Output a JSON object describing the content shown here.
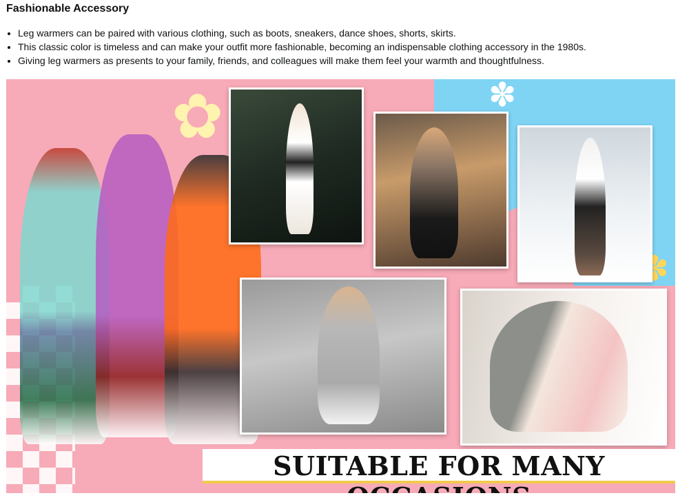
{
  "section": {
    "title": "Fashionable Accessory",
    "bullets": [
      "Leg warmers can be paired with various clothing, such as boots, sneakers, dance shoes, shorts, skirts.",
      "This classic color is timeless and can make your outfit more fashionable, becoming an indispensable clothing accessory in the 1980s.",
      "Giving leg warmers as presents to your family, friends, and colleagues will make them feel your warmth and thoughtfulness."
    ]
  },
  "banner": {
    "slogan": "SUITABLE FOR MANY OCCASIONS",
    "colors": {
      "pink": "#f7aab7",
      "blue": "#7fd4f4",
      "yellow": "#f2c94c"
    },
    "photos": [
      "tennis-player-photo",
      "cafe-photo",
      "snow-photo",
      "street-sitting-photo",
      "window-sitting-photo"
    ]
  }
}
